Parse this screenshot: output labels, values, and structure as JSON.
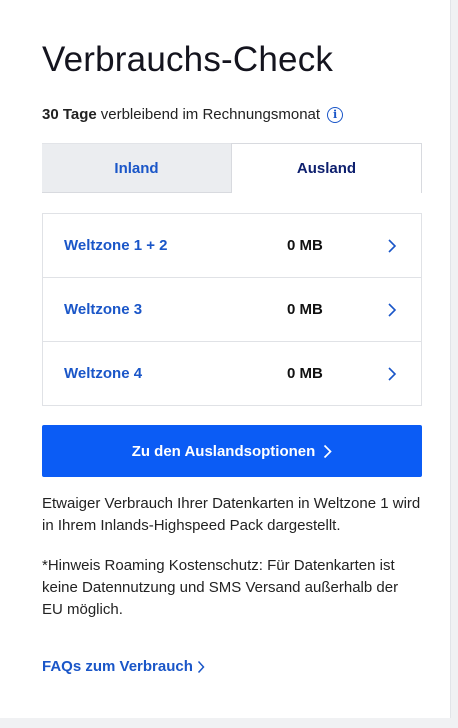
{
  "page": {
    "title": "Verbrauchs-Check",
    "days_bold": "30 Tage",
    "days_text": "verbleibend im Rechnungsmonat",
    "info_icon": "info-icon"
  },
  "tabs": [
    {
      "label": "Inland",
      "active": false
    },
    {
      "label": "Ausland",
      "active": true
    }
  ],
  "zones": [
    {
      "name": "Weltzone 1 + 2",
      "value": "0 MB"
    },
    {
      "name": "Weltzone 3",
      "value": "0 MB"
    },
    {
      "name": "Weltzone 4",
      "value": "0 MB"
    }
  ],
  "cta": {
    "label": "Zu den Auslandsoptionen"
  },
  "notes": {
    "p1": "Etwaiger Verbrauch Ihrer Datenkarten in Weltzone 1 wird in Ihrem Inlands-Highspeed Pack dargestellt.",
    "p2": "*Hinweis Roaming Kostenschutz: Für Datenkarten ist keine Datennutzung und SMS Versand außerhalb der EU möglich."
  },
  "faq": {
    "label": "FAQs zum Verbrauch"
  },
  "colors": {
    "accent_blue": "#1a56c8",
    "button_blue": "#0b5cf5",
    "dark_navy": "#0d1f6e"
  }
}
